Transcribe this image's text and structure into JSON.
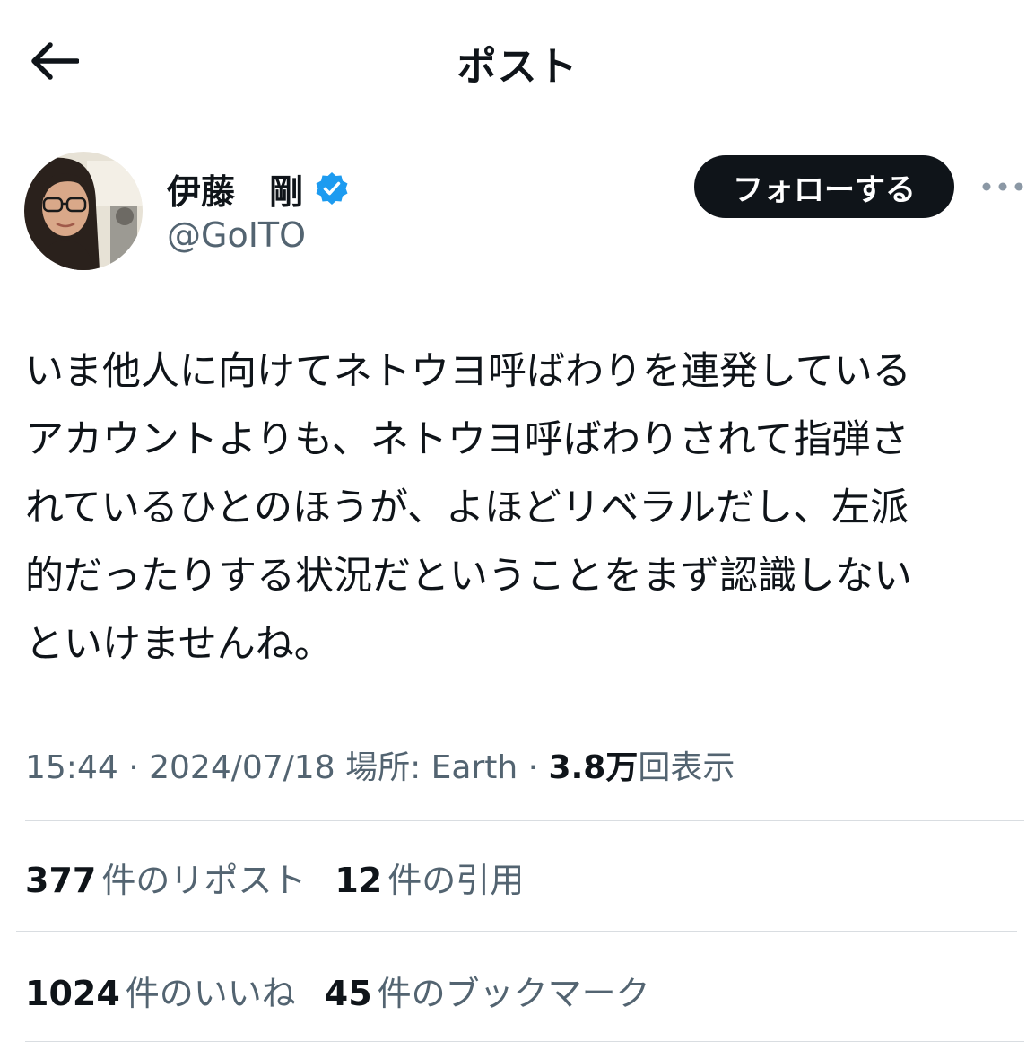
{
  "header": {
    "title": "ポスト",
    "back_icon": "arrow-left-icon"
  },
  "author": {
    "display_name": "伊藤　剛",
    "handle": "@GoITO",
    "verified_icon": "verified-badge-icon",
    "verified_color": "#1d9bf0"
  },
  "actions": {
    "follow_label": "フォローする",
    "more_icon": "more-horizontal-icon"
  },
  "post": {
    "text": "いま他人に向けてネトウヨ呼ばわりを連発している\nアカウントよりも、ネトウヨ呼ばわりされて指弾さ\nれているひとのほうが、よほどリベラルだし、左派\n的だったりする状況だということをまず認識しない\nといけませんね。"
  },
  "meta": {
    "time": "15:44",
    "separator": "·",
    "date": "2024/07/18",
    "location_label": "場所: Earth",
    "views_count": "3.8万",
    "views_label": "回表示"
  },
  "stats": {
    "reposts_count": "377",
    "reposts_label": "件のリポスト",
    "quotes_count": "12",
    "quotes_label": "件の引用",
    "likes_count": "1024",
    "likes_label": "件のいいね",
    "bookmarks_count": "45",
    "bookmarks_label": "件のブックマーク"
  },
  "colors": {
    "text_primary": "#0f1419",
    "text_secondary": "#536471",
    "follow_bg": "#0f1419",
    "divider": "#d9dde1"
  }
}
